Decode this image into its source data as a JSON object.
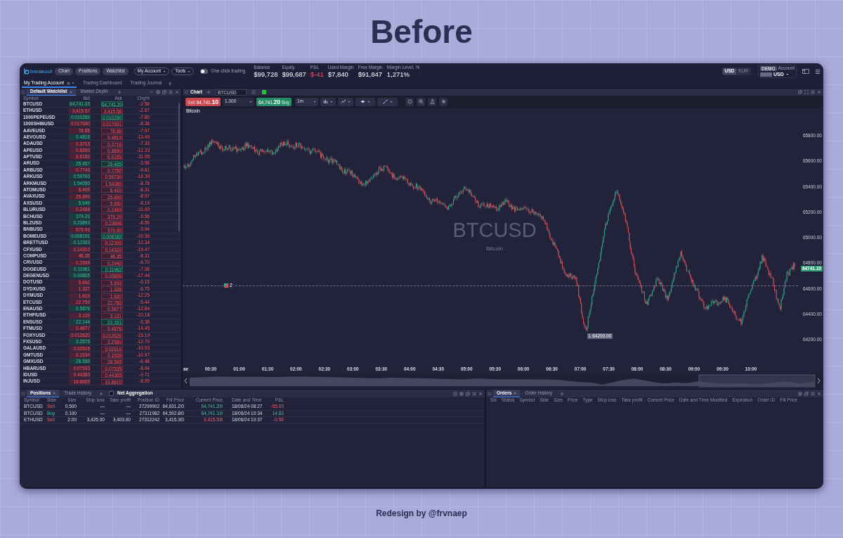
{
  "header": {
    "title": "Before"
  },
  "app": {
    "brand": "breakout",
    "nav_buttons": [
      "Chart",
      "Positions",
      "Watchlist"
    ],
    "menus": [
      "My Account",
      "Tools"
    ],
    "one_click_trading": {
      "label": "One-click trading",
      "on": false
    },
    "stats": [
      {
        "label": "Balance",
        "value": "$99,728",
        "negative": false
      },
      {
        "label": "Equity",
        "value": "$99,687",
        "negative": false
      },
      {
        "label": "P&L",
        "value": "$-41",
        "negative": true
      },
      {
        "label": "Used Margin",
        "value": "$7,840",
        "negative": false
      },
      {
        "label": "Free Margin",
        "value": "$91,847",
        "negative": false
      },
      {
        "label": "Margin Level, %",
        "value": "1,271%",
        "negative": false
      }
    ],
    "currencies": [
      {
        "label": "USD",
        "selected": true
      },
      {
        "label": "EUR",
        "selected": false
      }
    ],
    "account": {
      "badge": "DEMO",
      "label": "Account",
      "currency": "USD"
    },
    "workspace_tabs": [
      {
        "label": "My Trading Account",
        "selected": true
      },
      {
        "label": "Trading Dashboard",
        "selected": false
      },
      {
        "label": "Trading Journal",
        "selected": false
      }
    ],
    "watchlist": {
      "tabs": [
        {
          "label": "Default Watchlist",
          "selected": true
        },
        {
          "label": "Market Depth",
          "selected": false
        }
      ],
      "columns": [
        "Symbol",
        "Bid",
        "Ask",
        "Chg%"
      ],
      "rows": [
        {
          "symbol": "BTCUSD",
          "bid": "64,741.10",
          "bid_up": true,
          "ask": "64,741.20",
          "ask_up": true,
          "chg": "-2.58"
        },
        {
          "symbol": "ETHUSD",
          "bid": "3,415.57",
          "bid_up": false,
          "ask": "3,415.58",
          "ask_up": false,
          "chg": "-2.67"
        },
        {
          "symbol": "1000PEPEUSD",
          "bid": "0.010289",
          "bid_up": true,
          "ask": "0.010290",
          "ask_up": true,
          "chg": "-7.80"
        },
        {
          "symbol": "1000SHIBUSD",
          "bid": "0.017690",
          "bid_up": false,
          "ask": "0.017691",
          "ask_up": false,
          "chg": "-8.38"
        },
        {
          "symbol": "AAVEUSD",
          "bid": "78.85",
          "bid_up": false,
          "ask": "78.86",
          "ask_up": false,
          "chg": "-7.07"
        },
        {
          "symbol": "AEVOUSD",
          "bid": "0.4818",
          "bid_up": true,
          "ask": "0.4819",
          "ask_up": false,
          "chg": "-13.49"
        },
        {
          "symbol": "ADAUSD",
          "bid": "0.3715",
          "bid_up": false,
          "ask": "0.3716",
          "ask_up": false,
          "chg": "-7.33"
        },
        {
          "symbol": "APEUSD",
          "bid": "0.8890",
          "bid_up": false,
          "ask": "0.8890",
          "ask_up": false,
          "chg": "-12.33"
        },
        {
          "symbol": "APTUSD",
          "bid": "6.6150",
          "bid_up": false,
          "ask": "6.6155",
          "ask_up": false,
          "chg": "-11.05"
        },
        {
          "symbol": "ARUSD",
          "bid": "25.457",
          "bid_up": true,
          "ask": "25.465",
          "ask_up": true,
          "chg": "-3.96"
        },
        {
          "symbol": "ARBUSD",
          "bid": "0.7749",
          "bid_up": false,
          "ask": "0.7750",
          "ask_up": false,
          "chg": "-9.61"
        },
        {
          "symbol": "ARKUSD",
          "bid": "0.59700",
          "bid_up": true,
          "ask": "0.59730",
          "ask_up": false,
          "chg": "-16.39"
        },
        {
          "symbol": "ARKMUSD",
          "bid": "1.54050",
          "bid_up": true,
          "ask": "1.54080",
          "ask_up": false,
          "chg": "-8.78"
        },
        {
          "symbol": "ATOMUSD",
          "bid": "6.409",
          "bid_up": false,
          "ask": "6.410",
          "ask_up": false,
          "chg": "-8.31"
        },
        {
          "symbol": "AVAXUSD",
          "bid": "25.890",
          "bid_up": false,
          "ask": "25.890",
          "ask_up": false,
          "chg": "-8.97"
        },
        {
          "symbol": "AXSUSD",
          "bid": "5.649",
          "bid_up": true,
          "ask": "5.650",
          "ask_up": false,
          "chg": "-8.19"
        },
        {
          "symbol": "BLURUSD",
          "bid": "0.2468",
          "bid_up": false,
          "ask": "0.2469",
          "ask_up": false,
          "chg": "-11.00"
        },
        {
          "symbol": "BCHUSD",
          "bid": "379.20",
          "bid_up": true,
          "ask": "379.20",
          "ask_up": false,
          "chg": "-9.56"
        },
        {
          "symbol": "BLZUSD",
          "bid": "0.23893",
          "bid_up": true,
          "ask": "0.23898",
          "ask_up": false,
          "chg": "-8.55"
        },
        {
          "symbol": "BNBUSD",
          "bid": "579.90",
          "bid_up": false,
          "ask": "579.90",
          "ask_up": false,
          "chg": "-3.94"
        },
        {
          "symbol": "BOMEUSD",
          "bid": "0.008191",
          "bid_up": true,
          "ask": "0.008183",
          "ask_up": true,
          "chg": "-10.36"
        },
        {
          "symbol": "BRETTUSD",
          "bid": "0.12303",
          "bid_up": true,
          "ask": "0.12305",
          "ask_up": false,
          "chg": "-12.34"
        },
        {
          "symbol": "CFXUSD",
          "bid": "0.14310",
          "bid_up": false,
          "ask": "0.14320",
          "ask_up": false,
          "chg": "-19.47"
        },
        {
          "symbol": "COMPUSD",
          "bid": "46.35",
          "bid_up": false,
          "ask": "46.35",
          "ask_up": false,
          "chg": "-8.31"
        },
        {
          "symbol": "CRVUSD",
          "bid": "0.2939",
          "bid_up": false,
          "ask": "0.2940",
          "ask_up": false,
          "chg": "-6.70"
        },
        {
          "symbol": "DOGEUSD",
          "bid": "0.11961",
          "bid_up": true,
          "ask": "0.11962",
          "ask_up": true,
          "chg": "-7.06"
        },
        {
          "symbol": "DEGENUSD",
          "bid": "0.00805",
          "bid_up": true,
          "ask": "0.00806",
          "ask_up": false,
          "chg": "-17.44"
        },
        {
          "symbol": "DOTUSD",
          "bid": "5.692",
          "bid_up": false,
          "ask": "5.693",
          "ask_up": false,
          "chg": "-6.15"
        },
        {
          "symbol": "DYDXUSD",
          "bid": "1.327",
          "bid_up": false,
          "ask": "1.328",
          "ask_up": false,
          "chg": "-6.75"
        },
        {
          "symbol": "DYMUSD",
          "bid": "1.619",
          "bid_up": false,
          "ask": "1.620",
          "ask_up": false,
          "chg": "-12.25"
        },
        {
          "symbol": "ETCUSD",
          "bid": "22.750",
          "bid_up": false,
          "ask": "22.760",
          "ask_up": false,
          "chg": "-5.44"
        },
        {
          "symbol": "ENAUSD",
          "bid": "0.5876",
          "bid_up": true,
          "ask": "0.5877",
          "ask_up": false,
          "chg": "-12.84"
        },
        {
          "symbol": "ETHFIUSD",
          "bid": "3.129",
          "bid_up": false,
          "ask": "3.131",
          "ask_up": false,
          "chg": "-10.18"
        },
        {
          "symbol": "ENSUSD",
          "bid": "22.144",
          "bid_up": true,
          "ask": "22.151",
          "ask_up": true,
          "chg": "-3.38"
        },
        {
          "symbol": "FTMUSD",
          "bid": "0.4877",
          "bid_up": false,
          "ask": "0.4878",
          "ask_up": false,
          "chg": "-14.45"
        },
        {
          "symbol": "FOXYUSD",
          "bid": "0.012620",
          "bid_up": false,
          "ask": "0.012626",
          "ask_up": false,
          "chg": "-15.19"
        },
        {
          "symbol": "FXSUSD",
          "bid": "3.2575",
          "bid_up": true,
          "ask": "3.2580",
          "ask_up": false,
          "chg": "-12.70"
        },
        {
          "symbol": "GALAUSD",
          "bid": "0.02615",
          "bid_up": false,
          "ask": "0.02616",
          "ask_up": false,
          "chg": "-10.93"
        },
        {
          "symbol": "GMTUSD",
          "bid": "0.1534",
          "bid_up": false,
          "ask": "0.1535",
          "ask_up": false,
          "chg": "-10.97"
        },
        {
          "symbol": "GMXUSD",
          "bid": "28.590",
          "bid_up": true,
          "ask": "28.595",
          "ask_up": false,
          "chg": "-6.48"
        },
        {
          "symbol": "HBARUSD",
          "bid": "0.07533",
          "bid_up": false,
          "ask": "0.07535",
          "ask_up": false,
          "chg": "-8.04"
        },
        {
          "symbol": "IDUSD",
          "bid": "0.44350",
          "bid_up": false,
          "ask": "0.44365",
          "ask_up": false,
          "chg": "-9.71"
        },
        {
          "symbol": "INJUSD",
          "bid": "19.8600",
          "bid_up": false,
          "ask": "19.8610",
          "ask_up": false,
          "chg": "-8.05"
        }
      ]
    },
    "chart": {
      "tab": "Chart",
      "symbol": "BTCUSD",
      "sell": {
        "label": "Sell",
        "price": "64,741.10"
      },
      "quantity": "1.000",
      "buy": {
        "price": "64,741.20",
        "label": "Buy"
      },
      "timeframe": "1m",
      "instrument": "Bitcoin",
      "watermark": {
        "symbol": "BTCUSD",
        "name": "Bitcoin"
      },
      "price_axis": [
        "65800.00",
        "65600.00",
        "65400.00",
        "65200.00",
        "65000.00",
        "64800.00",
        "64600.00",
        "64400.00",
        "64200.00"
      ],
      "last_price": "64741.10",
      "position_marker": "2",
      "low_label": "L 64200.00",
      "time_axis": [
        "ae",
        "00:30",
        "01:00",
        "01:30",
        "02:00",
        "02:30",
        "03:00",
        "03:30",
        "04:00",
        "04:30",
        "05:00",
        "05:30",
        "06:00",
        "06:30",
        "07:00",
        "07:30",
        "08:00",
        "08:30",
        "09:00",
        "09:30",
        "10:00"
      ]
    },
    "positions": {
      "tabs": [
        {
          "label": "Positions",
          "selected": true
        },
        {
          "label": "Trade History",
          "selected": false
        }
      ],
      "net_aggregation": {
        "label": "Net Aggregation",
        "checked": false
      },
      "columns": [
        "Symbol",
        "Side",
        "Size",
        "Stop loss",
        "Take profit",
        "Position ID",
        "Fill Price",
        "Current Price",
        "Date and Time",
        "P&L"
      ],
      "rows": [
        {
          "symbol": "BTCUSD",
          "side": "Sell",
          "kind": "sell",
          "size": "0.500",
          "stop_loss": "—",
          "take_profit": "—",
          "position_id": "27299902",
          "fill_price": "64,631.20",
          "current_price": "64,741.20",
          "current_up": true,
          "date_time": "18/06/24 08:27",
          "pnl": "-55.00",
          "pnl_up": false
        },
        {
          "symbol": "BTCUSD",
          "side": "Buy",
          "kind": "buy",
          "size": "0.100",
          "stop_loss": "—",
          "take_profit": "—",
          "position_id": "27311982",
          "fill_price": "64,592.80",
          "current_price": "64,741.10",
          "current_up": true,
          "date_time": "18/06/24 10:34",
          "pnl": "14.83",
          "pnl_up": true
        },
        {
          "symbol": "ETHUSD",
          "side": "Sell",
          "kind": "sell",
          "size": "2.00",
          "stop_loss": "3,425.00",
          "take_profit": "3,403.00",
          "position_id": "27312242",
          "fill_price": "3,415.30",
          "current_price": "3,415.58",
          "current_up": false,
          "date_time": "18/06/24 10:37",
          "pnl": "-0.56",
          "pnl_up": false
        }
      ]
    },
    "orders": {
      "tabs": [
        {
          "label": "Orders",
          "selected": true
        },
        {
          "label": "Order History",
          "selected": false
        }
      ],
      "columns": [
        "Sis",
        "Status",
        "Symbol",
        "Side",
        "Size",
        "Price",
        "Type",
        "Stop loss",
        "Take profit",
        "Current Price",
        "Date and Time Modified",
        "Expiration",
        "Order ID",
        "Fill Price"
      ]
    }
  },
  "footer": {
    "credit": "Redesign by @frvnaep"
  }
}
